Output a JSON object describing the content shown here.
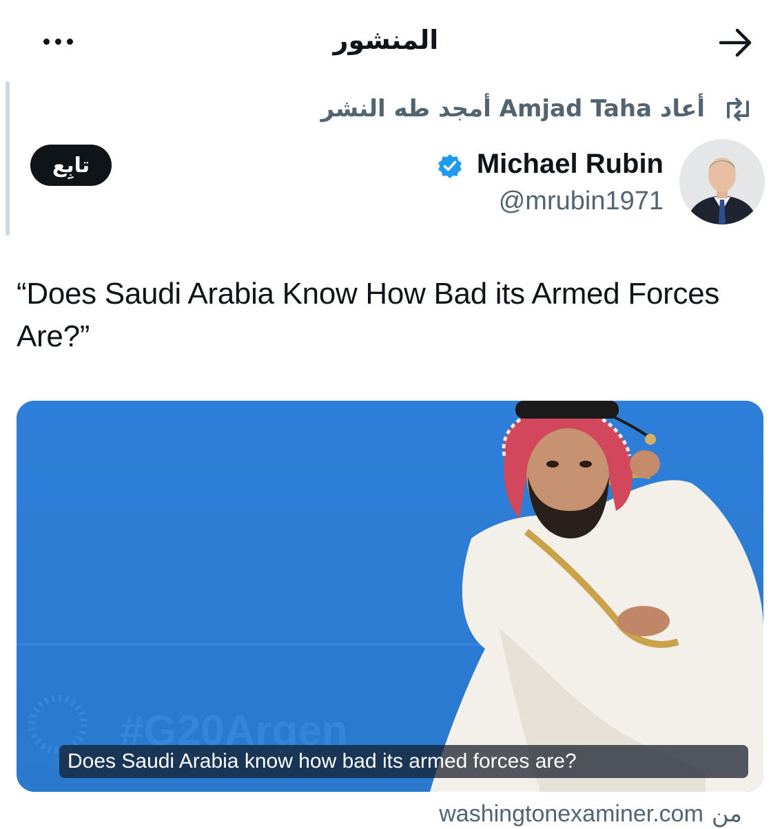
{
  "header": {
    "title": "المنشور",
    "back_icon": "arrow-right-icon",
    "more_icon": "more-horizontal-icon"
  },
  "retweet": {
    "text": "أعاد Amjad Taha أمجد طه النشر",
    "icon": "retweet-icon"
  },
  "author": {
    "name": "Michael Rubin",
    "handle": "@mrubin1971",
    "verified": true,
    "verified_color": "#1d9bf0",
    "follow_label": "تابِع"
  },
  "tweet": {
    "text": "“Does Saudi Arabia Know How Bad its Armed Forces Are?”"
  },
  "card": {
    "caption": "Does Saudi Arabia know how bad its armed forces are?",
    "background_color": "#2d80d6"
  },
  "source": {
    "from_label": "من",
    "domain": "washingtonexaminer.com"
  },
  "colors": {
    "text_primary": "#0f1419",
    "text_secondary": "#536471",
    "verified_blue": "#1d9bf0",
    "thread_line": "#cfd9de"
  }
}
